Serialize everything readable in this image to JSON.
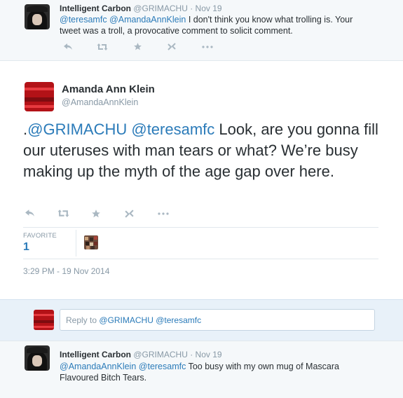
{
  "tweet1": {
    "name": "Intelligent Carbon",
    "handle": "@GRIMACHU",
    "separator": "·",
    "date": "Nov 19",
    "mention1": "@teresamfc",
    "mention2": "@AmandaAnnKlein",
    "text": " I don't think you know what trolling is. Your tweet was a troll, a provocative comment to solicit comment."
  },
  "tweet2": {
    "name": "Amanda Ann Klein",
    "handle": "@AmandaAnnKlein",
    "text_prefix": ".",
    "mention1": "@GRIMACHU",
    "mention2": "@teresamfc",
    "text": " Look, are you gonna fill our uteruses with man tears or what? We’re busy making up the myth of the age gap over here.",
    "favorite_label": "FAVORITE",
    "favorite_count": "1",
    "timestamp": "3:29 PM - 19 Nov 2014"
  },
  "reply": {
    "prefix": "Reply to ",
    "mention1": "@GRIMACHU",
    "mention2": "@teresamfc"
  },
  "tweet3": {
    "name": "Intelligent Carbon",
    "handle": "@GRIMACHU",
    "separator": "·",
    "date": "Nov 19",
    "mention1": "@AmandaAnnKlein",
    "mention2": "@teresamfc",
    "text": " Too busy with my own mug of Mascara Flavoured Bitch Tears."
  },
  "icons": {
    "reply": "reply-icon",
    "retweet": "retweet-icon",
    "favorite": "star-icon",
    "pocket": "pocket-icon",
    "more": "more-icon"
  },
  "colors": {
    "link": "#2b7bb9",
    "muted": "#8899a6",
    "action": "#aab8c2",
    "reply_bg": "#e8f1f9"
  }
}
